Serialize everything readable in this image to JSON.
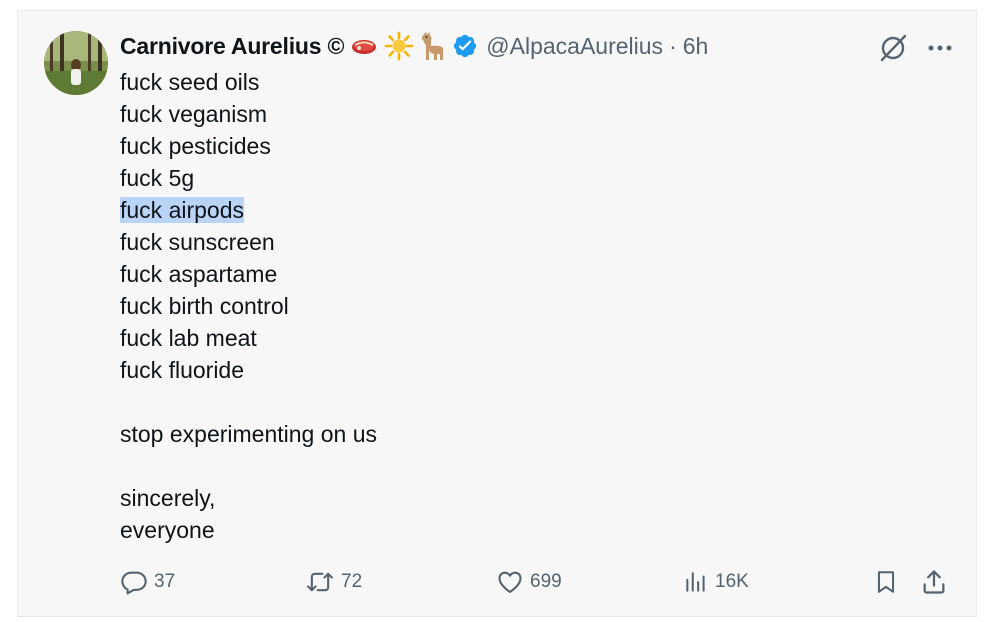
{
  "post": {
    "author_name": "Carnivore Aurelius ©",
    "handle": "@AlpacaAurelius",
    "separator": "·",
    "time": "6h",
    "badges": [
      "steak-emoji",
      "sun-emoji",
      "llama-emoji",
      "verified-badge-icon"
    ],
    "lines": [
      "fuck seed oils",
      "fuck veganism",
      "fuck pesticides",
      "fuck 5g",
      "fuck airpods",
      "fuck sunscreen",
      "fuck aspartame",
      "fuck birth control",
      "fuck lab meat",
      "fuck fluoride",
      "stop experimenting on us",
      "sincerely,",
      "everyone"
    ],
    "highlighted_line": "fuck airpods"
  },
  "actions": {
    "replies": "37",
    "reposts": "72",
    "likes": "699",
    "views": "16K"
  },
  "icons": {
    "more": "more-icon",
    "grok": "grok-icon",
    "reply": "reply-icon",
    "repost": "repost-icon",
    "like": "heart-icon",
    "views": "views-icon",
    "bookmark": "bookmark-icon",
    "share": "share-icon"
  },
  "colors": {
    "text": "#0f1419",
    "secondary": "#536471",
    "verified": "#1d9bf0",
    "highlight": "#b9d4f6",
    "background": "#f7f7f7"
  }
}
